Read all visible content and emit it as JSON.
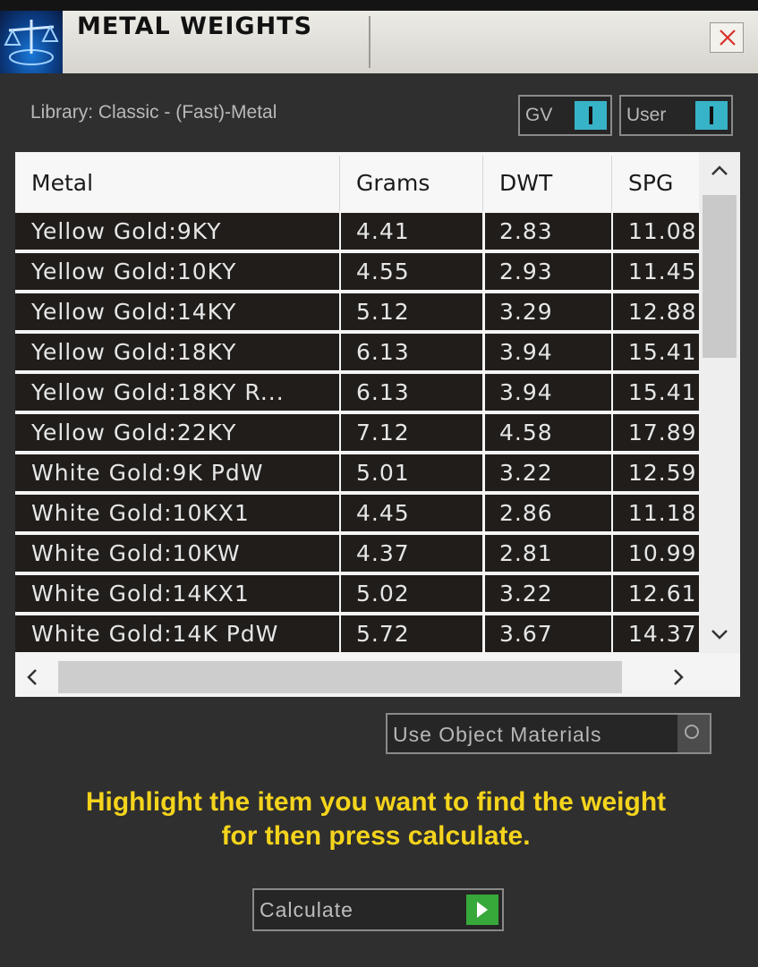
{
  "window": {
    "title": "METAL WEIGHTS",
    "close_icon": "close-icon",
    "app_icon": "scale-icon"
  },
  "library_label": "Library: Classic - (Fast)-Metal",
  "toggles": {
    "gv": {
      "label": "GV"
    },
    "user": {
      "label": "User"
    },
    "use_object_materials": {
      "label": "Use Object Materials"
    }
  },
  "colors": {
    "accent_toggle": "#37b3c7",
    "hint_text": "#f4d41c",
    "calculate_go": "#37a83a",
    "row_bg": "#201d1b"
  },
  "table": {
    "columns": [
      "Metal",
      "Grams",
      "DWT",
      "SPG"
    ],
    "rows": [
      [
        "Yellow Gold:9KY",
        "4.41",
        "2.83",
        "11.08"
      ],
      [
        "Yellow Gold:10KY",
        "4.55",
        "2.93",
        "11.45"
      ],
      [
        "Yellow Gold:14KY",
        "5.12",
        "3.29",
        "12.88"
      ],
      [
        "Yellow Gold:18KY",
        "6.13",
        "3.94",
        "15.41"
      ],
      [
        "Yellow Gold:18KY R...",
        "6.13",
        "3.94",
        "15.41"
      ],
      [
        "Yellow Gold:22KY",
        "7.12",
        "4.58",
        "17.89"
      ],
      [
        "White Gold:9K PdW",
        "5.01",
        "3.22",
        "12.59"
      ],
      [
        "White Gold:10KX1",
        "4.45",
        "2.86",
        "11.18"
      ],
      [
        "White Gold:10KW",
        "4.37",
        "2.81",
        "10.99"
      ],
      [
        "White Gold:14KX1",
        "5.02",
        "3.22",
        "12.61"
      ],
      [
        "White Gold:14K PdW",
        "5.72",
        "3.67",
        "14.37"
      ]
    ]
  },
  "hint": {
    "line1": "Highlight the item you want to find the weight",
    "line2": "for then press calculate."
  },
  "calculate": {
    "label": "Calculate",
    "icon": "play-icon"
  }
}
